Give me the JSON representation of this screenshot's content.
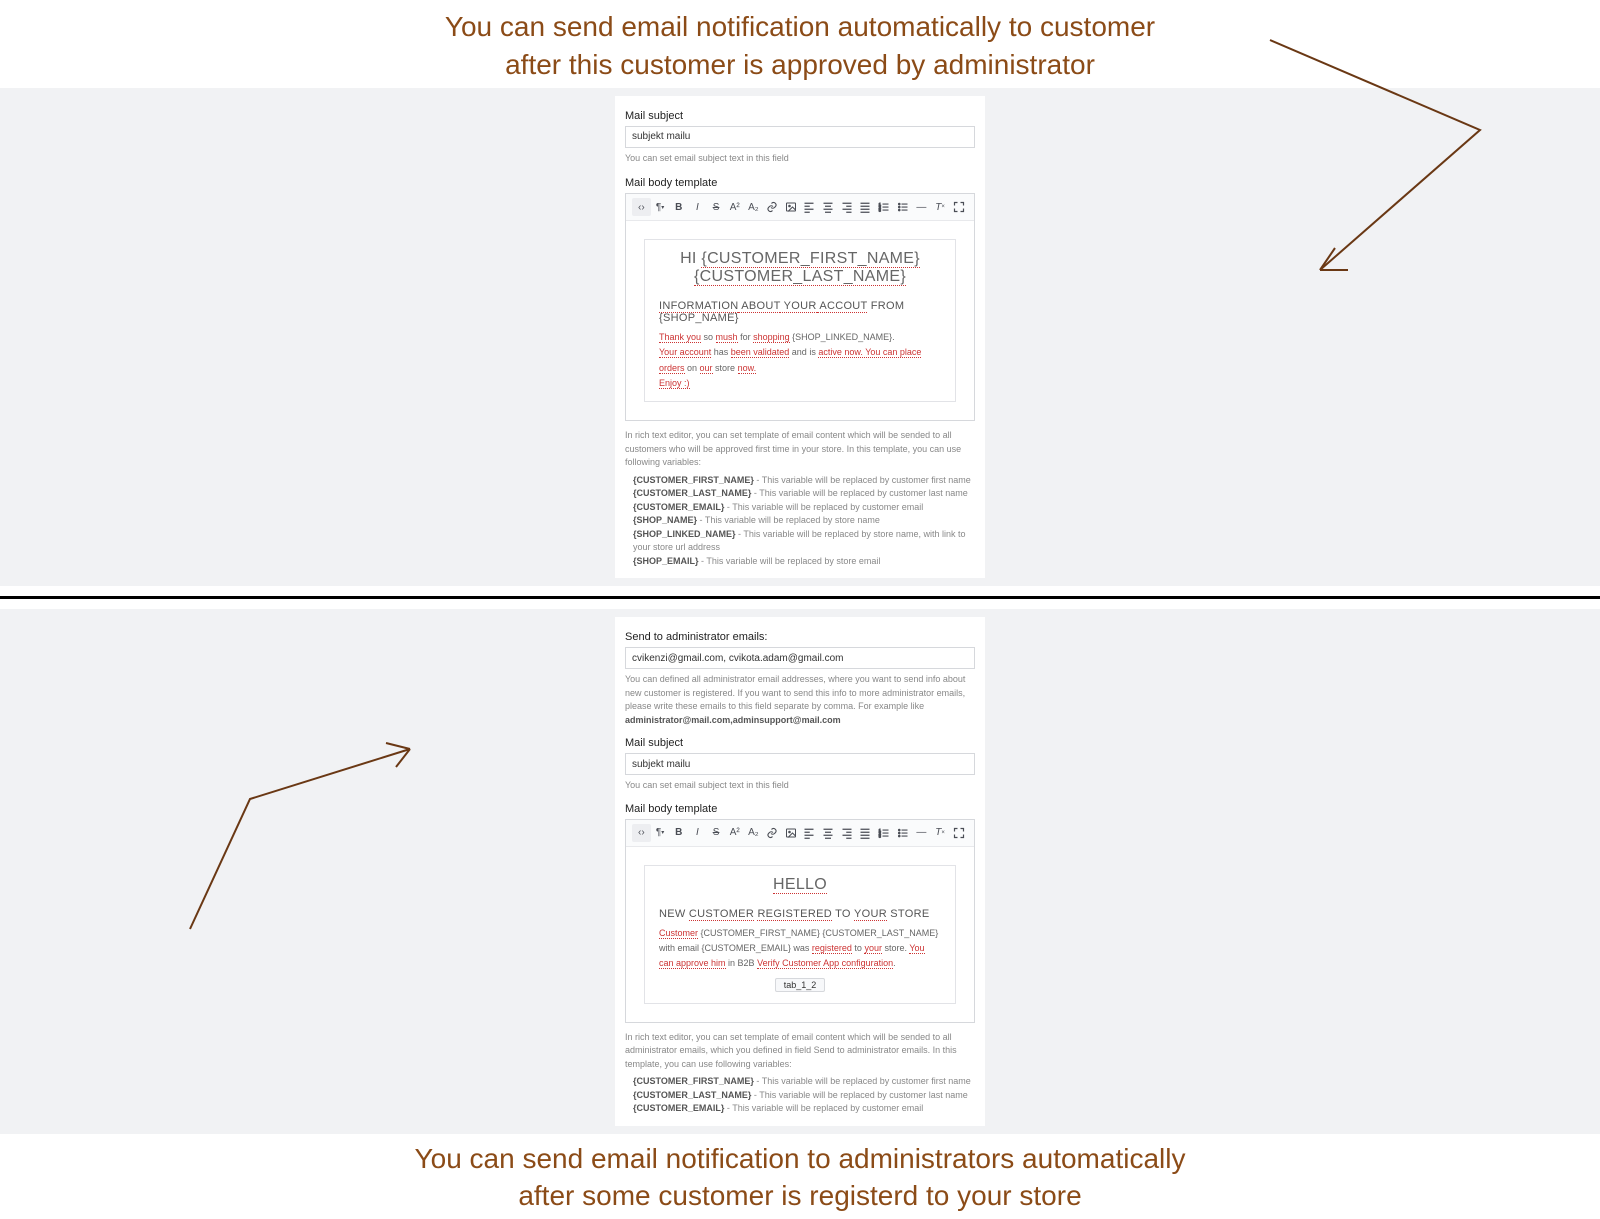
{
  "hero_top_line1": "You can send email notification automatically to customer",
  "hero_top_line2": "after this customer is approved by administrator",
  "hero_bottom_line1": "You can send email notification to administrators automatically",
  "hero_bottom_line2": "after some customer is registerd to your store",
  "panel1": {
    "subject_label": "Mail subject",
    "subject_value": "subjekt mailu",
    "subject_help": "You can set email subject text in this field",
    "body_label": "Mail body template",
    "tpl_h1_a": "HI ",
    "tpl_h1_b": "{CUSTOMER_FIRST_NAME}",
    "tpl_h1_c": "{CUSTOMER_LAST_NAME}",
    "tpl_section_a": "INFORMATION",
    "tpl_section_b": " ABOUT",
    "tpl_section_c": " YOUR",
    "tpl_section_d": " ACCOUT",
    "tpl_section_e": " FROM {SHOP_NAME}",
    "tpl_p1_a": "Thank you",
    "tpl_p1_b": " so ",
    "tpl_p1_c": "mush",
    "tpl_p1_d": " for ",
    "tpl_p1_e": "shopping",
    "tpl_p1_f": " {SHOP_LINKED_NAME}.",
    "tpl_p2_a": "Your account",
    "tpl_p2_b": " has ",
    "tpl_p2_c": "been validated",
    "tpl_p2_d": " and is ",
    "tpl_p2_e": "active now. You can place orders",
    "tpl_p2_f": " on ",
    "tpl_p2_g": "our",
    "tpl_p2_h": " store ",
    "tpl_p2_i": "now.",
    "tpl_p3": "Enjoy :)",
    "post_help": "In rich text editor, you can set template of email content which will be sended to all customers who will be approved first time in your store. In this template, you can use following variables:",
    "vars": [
      {
        "k": "{CUSTOMER_FIRST_NAME}",
        "v": " - This variable will be replaced by customer first name"
      },
      {
        "k": "{CUSTOMER_LAST_NAME}",
        "v": " - This variable will be replaced by customer last name"
      },
      {
        "k": "{CUSTOMER_EMAIL}",
        "v": " - This variable will be replaced by customer email"
      },
      {
        "k": "{SHOP_NAME}",
        "v": " - This variable will be replaced by store name"
      },
      {
        "k": "{SHOP_LINKED_NAME}",
        "v": " - This variable will be replaced by store name, with link to your store url address"
      },
      {
        "k": "{SHOP_EMAIL}",
        "v": " - This variable will be replaced by store email"
      }
    ]
  },
  "panel2": {
    "admins_label": "Send to administrator emails:",
    "admins_value": "cvikenzi@gmail.com, cvikota.adam@gmail.com",
    "admins_help_a": "You can defined all administrator email addresses, where you want to send info about new customer is registered. If you want to send this info to more administrator emails, please write these emails to this field separate by comma. For example like ",
    "admins_help_b": "administrator@mail.com,adminsupport@mail.com",
    "subject_label": "Mail subject",
    "subject_value": "subjekt mailu",
    "subject_help": "You can set email subject text in this field",
    "body_label": "Mail body template",
    "tpl_h1": "HELLO",
    "tpl_section_a": "NEW ",
    "tpl_section_b": "CUSTOMER",
    "tpl_section_c": " ",
    "tpl_section_d": "REGISTERED",
    "tpl_section_e": " TO ",
    "tpl_section_f": "YOUR",
    "tpl_section_g": " STORE",
    "tpl_p1_a": "Customer",
    "tpl_p1_b": " {CUSTOMER_FIRST_NAME} {CUSTOMER_LAST_NAME} with email {CUSTOMER_EMAIL} was ",
    "tpl_p1_c": "registered",
    "tpl_p1_d": " to ",
    "tpl_p1_e": "your",
    "tpl_p1_f": " store. ",
    "tpl_p1_g": "You can approve him",
    "tpl_p1_h": " in B2B ",
    "tpl_p1_i": "Verify Customer App configuration",
    "tpl_p1_j": ".",
    "tag": "tab_1_2",
    "post_help": "In rich text editor, you can set template of email content which will be sended to all administrator emails, which you defined in field Send to administrator emails. In this template, you can use following variables:",
    "vars": [
      {
        "k": "{CUSTOMER_FIRST_NAME}",
        "v": " - This variable will be replaced by customer first name"
      },
      {
        "k": "{CUSTOMER_LAST_NAME}",
        "v": " - This variable will be replaced by customer last name"
      },
      {
        "k": "{CUSTOMER_EMAIL}",
        "v": " - This variable will be replaced by customer email"
      }
    ]
  },
  "arrow_color": "#6a3814"
}
